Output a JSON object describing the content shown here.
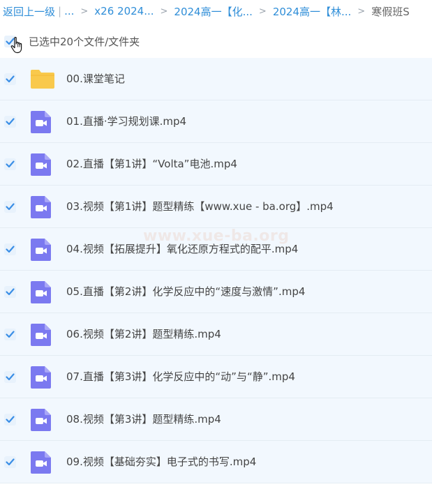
{
  "breadcrumb": {
    "back": "返回上一级",
    "separator": "|",
    "ellipsis": "...",
    "items": [
      "x26 2024...",
      "2024高一【化...",
      "2024高一【林..."
    ],
    "current": "寒假班S"
  },
  "selection": {
    "label": "已选中20个文件/文件夹",
    "checked": true
  },
  "files": [
    {
      "name": "00.课堂笔记",
      "type": "folder",
      "checked": true
    },
    {
      "name": "01.直播·学习规划课.mp4",
      "type": "video",
      "checked": true
    },
    {
      "name": "02.直播【第1讲】“Volta”电池.mp4",
      "type": "video",
      "checked": true
    },
    {
      "name": "03.视频【第1讲】题型精练【www.xue - ba.org】.mp4",
      "type": "video",
      "checked": true
    },
    {
      "name": "04.视频【拓展提升】氧化还原方程式的配平.mp4",
      "type": "video",
      "checked": true
    },
    {
      "name": "05.直播【第2讲】化学反应中的“速度与激情”.mp4",
      "type": "video",
      "checked": true
    },
    {
      "name": "06.视频【第2讲】题型精练.mp4",
      "type": "video",
      "checked": true
    },
    {
      "name": "07.直播【第3讲】化学反应中的“动”与“静”.mp4",
      "type": "video",
      "checked": true
    },
    {
      "name": "08.视频【第3讲】题型精练.mp4",
      "type": "video",
      "checked": true
    },
    {
      "name": "09.视频【基础夯实】电子式的书写.mp4",
      "type": "video",
      "checked": true
    }
  ],
  "watermark": "www.xue-ba.org",
  "colors": {
    "link": "#2f8ed8",
    "checkbox": "#3a8ee6",
    "folder": "#f9c94c",
    "video": "#7b79f0",
    "row_bg": "#f2f8fe"
  }
}
